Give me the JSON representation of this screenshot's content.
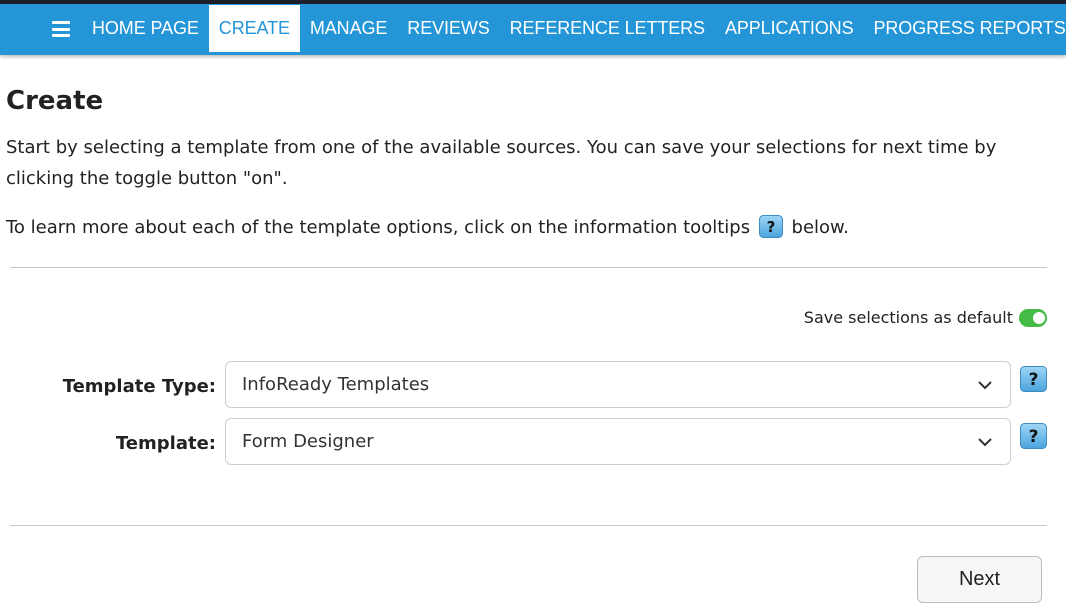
{
  "nav": {
    "items": [
      {
        "label": "HOME PAGE",
        "active": false
      },
      {
        "label": "CREATE",
        "active": true
      },
      {
        "label": "MANAGE",
        "active": false
      },
      {
        "label": "REVIEWS",
        "active": false
      },
      {
        "label": "REFERENCE LETTERS",
        "active": false
      },
      {
        "label": "APPLICATIONS",
        "active": false
      },
      {
        "label": "PROGRESS REPORTS",
        "active": false
      }
    ],
    "bar_color": "#2496d8"
  },
  "page": {
    "title": "Create",
    "intro": "Start by selecting a template from one of the available sources. You can save your selections for next time by clicking the toggle button \"on\".",
    "learn_prefix": "To learn more about each of the template options, click on the information tooltips",
    "learn_suffix": "below."
  },
  "defaults": {
    "label": "Save selections as default",
    "toggle_on": true,
    "toggle_color": "#44bb44"
  },
  "form": {
    "template_type": {
      "label": "Template Type:",
      "value": "InfoReady Templates"
    },
    "template": {
      "label": "Template:",
      "value": "Form Designer"
    }
  },
  "actions": {
    "next_label": "Next"
  },
  "icons": {
    "menu": "hamburger-icon",
    "help": "question-mark-icon",
    "dropdown": "chevron-down-icon"
  }
}
